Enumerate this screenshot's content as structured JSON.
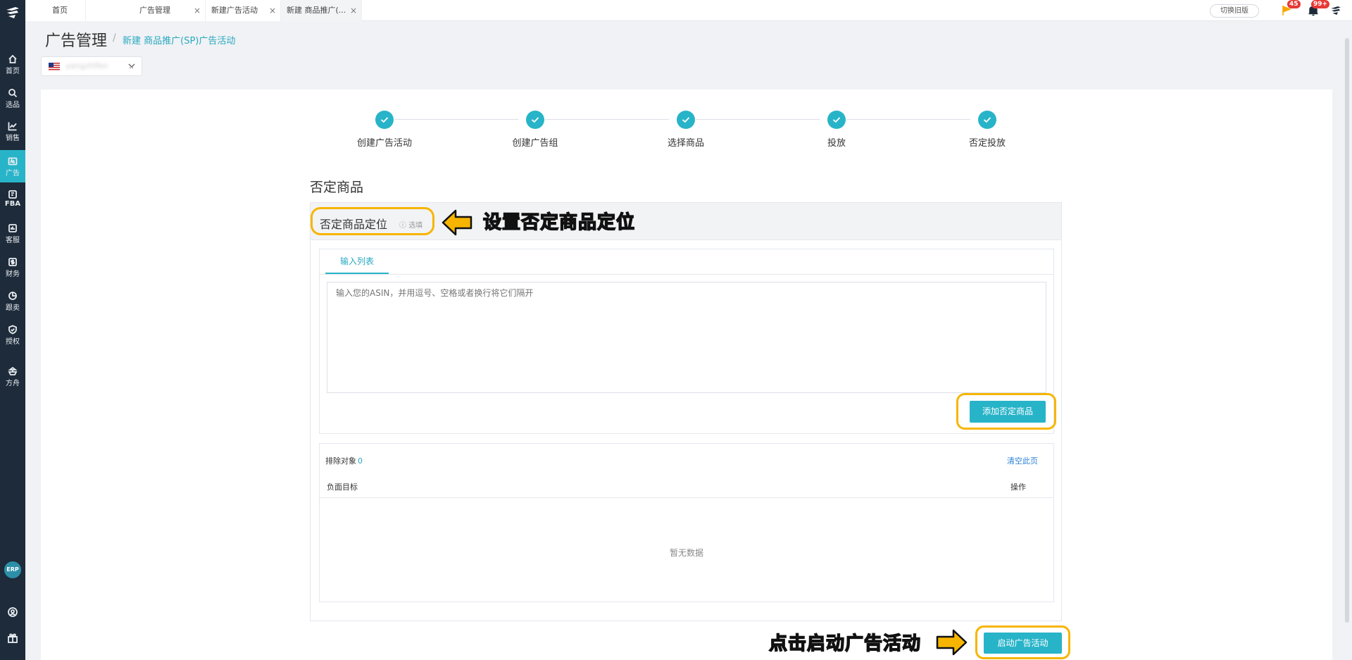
{
  "sidebar": {
    "items": [
      {
        "label": "首页",
        "icon": "home-icon"
      },
      {
        "label": "选品",
        "icon": "search-icon"
      },
      {
        "label": "销售",
        "icon": "chart-line-icon"
      },
      {
        "label": "广告",
        "icon": "ad-icon"
      },
      {
        "label": "FBA",
        "icon": "fba-icon"
      },
      {
        "label": "客服",
        "icon": "service-icon"
      },
      {
        "label": "财务",
        "icon": "finance-icon"
      },
      {
        "label": "跟卖",
        "icon": "pie-chart-icon"
      },
      {
        "label": "授权",
        "icon": "shield-icon"
      },
      {
        "label": "方舟",
        "icon": "ark-icon"
      }
    ],
    "erp_label": "ERP"
  },
  "tabs": [
    {
      "label": "首页"
    },
    {
      "label": "广告管理"
    },
    {
      "label": "新建广告活动"
    },
    {
      "label": "新建 商品推广(..."
    }
  ],
  "topbar": {
    "switch_label": "切换旧版",
    "flag_badge": "45",
    "bell_badge": "99+"
  },
  "header": {
    "title": "广告管理",
    "separator": "/",
    "breadcrumb": "新建 商品推广(SP)广告活动"
  },
  "shop_select": {
    "name": "yangzhifen",
    "suffix": ".."
  },
  "steps": [
    {
      "label": "创建广告活动"
    },
    {
      "label": "创建广告组"
    },
    {
      "label": "选择商品"
    },
    {
      "label": "投放"
    },
    {
      "label": "否定投放"
    }
  ],
  "section": {
    "title": "否定商品",
    "box_title": "否定商品定位",
    "optional": "选填",
    "input_tab": "输入列表",
    "textarea_placeholder": "输入您的ASIN，并用逗号、空格或者换行将它们隔开",
    "add_button": "添加否定商品",
    "excluded_label": "排除对象",
    "excluded_count": "0",
    "clear_page": "清空此页",
    "col_target": "负面目标",
    "col_action": "操作",
    "empty": "暂无数据"
  },
  "footer": {
    "launch_button": "启动广告活动"
  },
  "annotations": {
    "top": "设置否定商品定位",
    "bottom": "点击启动广告活动"
  },
  "colors": {
    "accent": "#28b4c8",
    "sidebar": "#1e2b3a",
    "highlight": "#f7b500"
  }
}
